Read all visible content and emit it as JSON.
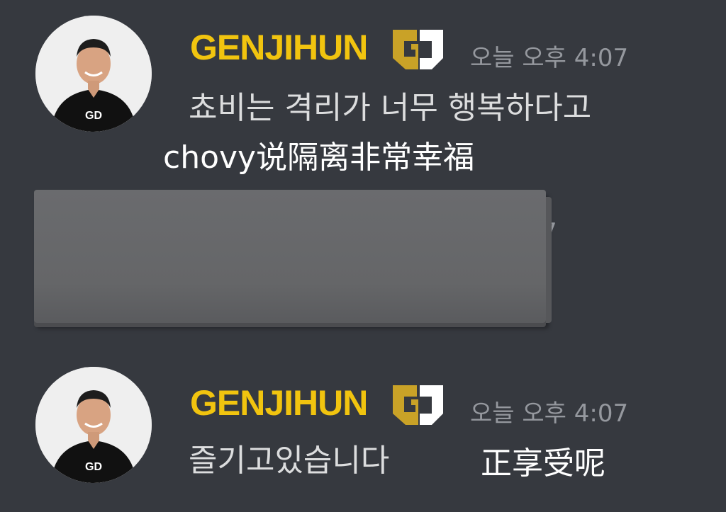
{
  "messages": [
    {
      "author": "GENJIHUN",
      "badge": "gen-g-team-badge",
      "timestamp": "오늘 오후 4:07",
      "text": "쵸비는 격리가 너무 행복하다고",
      "caption": "chovy说隔离非常幸福"
    },
    {
      "author": "GENJIHUN",
      "badge": "gen-g-team-badge",
      "timestamp": "오늘 오후 4:07",
      "text": "즐기고있습니다",
      "caption": "正享受呢"
    }
  ],
  "redacted_block": {
    "peek_text": "7"
  },
  "colors": {
    "background": "#36393f",
    "username": "#f1c40f",
    "timestamp": "#95989e",
    "message_text": "#dcddde",
    "caption_text": "#ffffff",
    "redaction": "#666769"
  }
}
